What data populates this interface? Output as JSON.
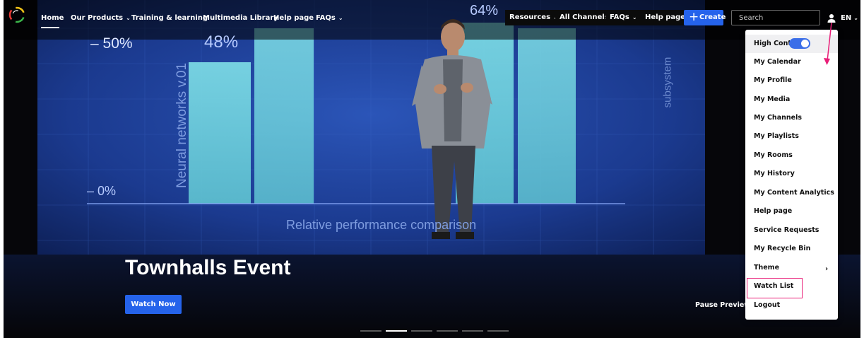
{
  "nav": {
    "home": "Home",
    "our_products": "Our Products",
    "training": "Training & learning",
    "multimedia": "Multimedia Library",
    "help": "Help page",
    "faqs": "FAQs",
    "chevron": "⌄"
  },
  "nav_right": {
    "resources": "Resources",
    "all_channels": "All Channels",
    "faqs": "FAQs",
    "help": "Help page",
    "create": "Create",
    "search_placeholder": "Search",
    "language": "EN"
  },
  "user_menu": {
    "items": [
      "High Contrast",
      "My Calendar",
      "My Profile",
      "My Media",
      "My Channels",
      "My Playlists",
      "My Rooms",
      "My History",
      "My Content Analytics",
      "Help page",
      "Service Requests",
      "My Recycle Bin",
      "Theme",
      "Watch List",
      "Logout"
    ],
    "high_contrast_on": true,
    "theme_chevron": "›"
  },
  "hero": {
    "title": "Townhalls Event",
    "watch_now": "Watch Now",
    "pause_preview": "Pause Preview",
    "background_text": {
      "pct_50": "– 50%",
      "pct_48": "48%",
      "pct_64": "64%",
      "pct_0": "– 0%",
      "vertical_left": "Neural networks v.01",
      "vertical_right": "subsystem",
      "caption": "Relative performance comparison"
    }
  },
  "carousel": {
    "count": 6,
    "active_index": 1
  },
  "colors": {
    "accent": "#2563eb",
    "annotation": "#e91e78",
    "toggle": "#3b6ee8",
    "screen": "#1a3a8c"
  },
  "icons": [
    "logo-icon",
    "chevron-down-icon",
    "plus-icon",
    "user-icon",
    "chevron-right-icon",
    "annotation-arrow-icon"
  ]
}
